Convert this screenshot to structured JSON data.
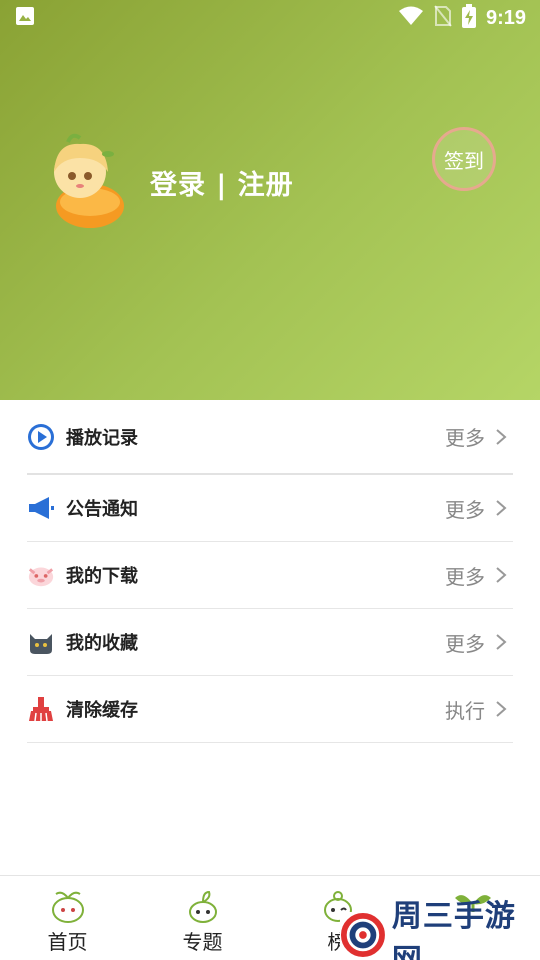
{
  "status_bar": {
    "time": "9:19"
  },
  "header": {
    "auth_label": "登录 | 注册",
    "checkin_label": "签到"
  },
  "menu": {
    "items": [
      {
        "label": "播放记录",
        "action": "更多",
        "icon": "play-circle-icon",
        "color": "#2a6fd6"
      },
      {
        "label": "公告通知",
        "action": "更多",
        "icon": "megaphone-icon",
        "color": "#2a6fd6"
      },
      {
        "label": "我的下载",
        "action": "更多",
        "icon": "pig-mascot-icon",
        "color": "#f0a0a8"
      },
      {
        "label": "我的收藏",
        "action": "更多",
        "icon": "cat-icon",
        "color": "#4a5560"
      },
      {
        "label": "清除缓存",
        "action": "执行",
        "icon": "broom-icon",
        "color": "#e04040"
      }
    ]
  },
  "bottom_nav": {
    "items": [
      {
        "label": "首页",
        "icon": "sprout-mascot-icon"
      },
      {
        "label": "专题",
        "icon": "sprout-mascot-icon"
      },
      {
        "label": "榜",
        "icon": "sprout-mascot-icon"
      },
      {
        "label": "",
        "icon": "sprout-icon"
      }
    ]
  },
  "watermark": {
    "text": "周三手游网"
  },
  "colors": {
    "header_start": "#8aa234",
    "header_end": "#b5d566",
    "accent_green": "#7fb13a"
  }
}
